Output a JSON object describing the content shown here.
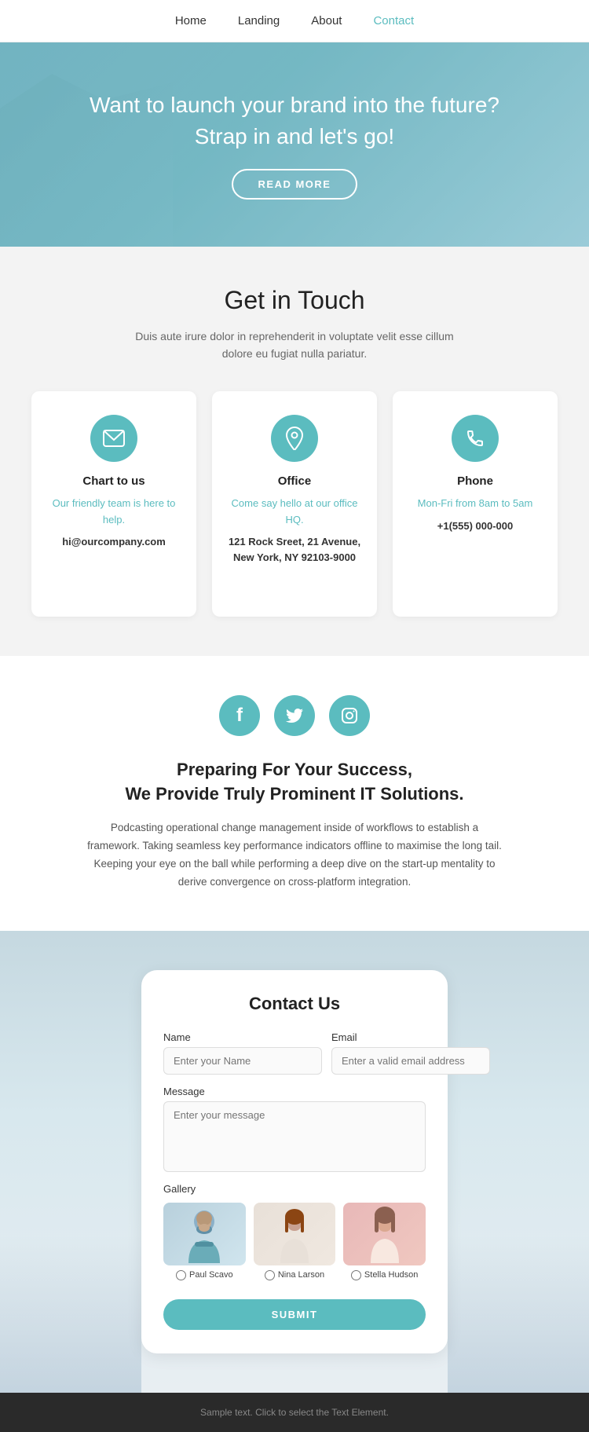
{
  "nav": {
    "items": [
      {
        "label": "Home",
        "active": false
      },
      {
        "label": "Landing",
        "active": false
      },
      {
        "label": "About",
        "active": false
      },
      {
        "label": "Contact",
        "active": true
      }
    ]
  },
  "hero": {
    "headline": "Want to launch your brand into the future? Strap in and let's go!",
    "cta_label": "READ MORE"
  },
  "get_in_touch": {
    "title": "Get in Touch",
    "description": "Duis aute irure dolor in reprehenderit in voluptate velit esse cillum dolore eu fugiat nulla pariatur.",
    "cards": [
      {
        "icon": "✉",
        "title": "Chart to us",
        "sub": "Our friendly team is here to help.",
        "detail": "hi@ourcompany.com"
      },
      {
        "icon": "📍",
        "title": "Office",
        "sub": "Come say hello at our office HQ.",
        "detail": "121 Rock Sreet, 21 Avenue,\nNew York, NY 92103-9000"
      },
      {
        "icon": "📞",
        "title": "Phone",
        "sub": "Mon-Fri from 8am to 5am",
        "detail": "+1(555) 000-000"
      }
    ]
  },
  "social": {
    "icons": [
      "f",
      "t",
      "ig"
    ],
    "headline_line1": "Preparing For Your Success,",
    "headline_line2": "We Provide Truly Prominent IT Solutions.",
    "description": "Podcasting operational change management inside of workflows to establish a framework. Taking seamless key performance indicators offline to maximise the long tail. Keeping your eye on the ball while performing a deep dive on the start-up mentality to derive convergence on cross-platform integration."
  },
  "contact_form": {
    "title": "Contact Us",
    "name_label": "Name",
    "name_placeholder": "Enter your Name",
    "email_label": "Email",
    "email_placeholder": "Enter a valid email address",
    "message_label": "Message",
    "message_placeholder": "Enter your message",
    "gallery_label": "Gallery",
    "gallery_items": [
      {
        "name": "Paul Scavo"
      },
      {
        "name": "Nina Larson"
      },
      {
        "name": "Stella Hudson"
      }
    ],
    "submit_label": "SUBMIT"
  },
  "footer": {
    "text": "Sample text. Click to select the Text Element."
  }
}
